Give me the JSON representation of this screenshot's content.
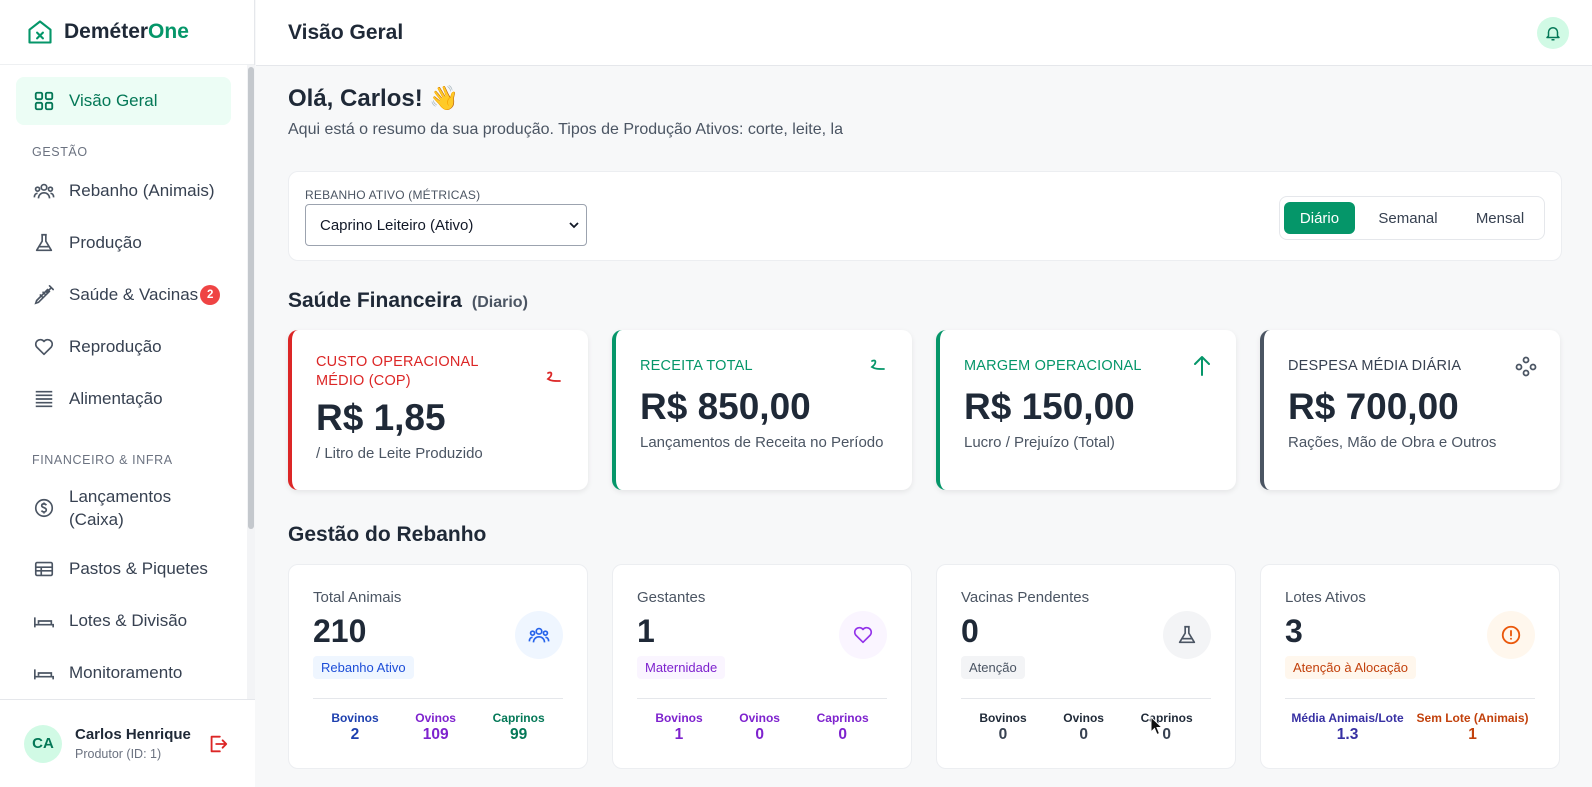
{
  "app": {
    "name_main": "Deméter",
    "name_accent": "One"
  },
  "sidebar": {
    "active": {
      "label": "Visão Geral",
      "icon": "grid-icon"
    },
    "sections": [
      {
        "title": "GESTÃO",
        "items": [
          {
            "label": "Rebanho (Animais)",
            "icon": "users-icon"
          },
          {
            "label": "Produção",
            "icon": "flask-icon"
          },
          {
            "label": "Saúde & Vacinas",
            "icon": "syringe-icon",
            "badge": "2"
          },
          {
            "label": "Reprodução",
            "icon": "heart-icon"
          },
          {
            "label": "Alimentação",
            "icon": "lines-icon"
          }
        ]
      },
      {
        "title": "FINANCEIRO & INFRA",
        "items": [
          {
            "label": "Lançamentos (Caixa)",
            "icon": "dollar-circle-icon"
          },
          {
            "label": "Pastos & Piquetes",
            "icon": "table-icon"
          },
          {
            "label": "Lotes & Divisão",
            "icon": "bed-icon"
          },
          {
            "label": "Monitoramento",
            "icon": "bed-icon"
          }
        ]
      }
    ],
    "user": {
      "initials": "CA",
      "name": "Carlos Henrique",
      "role": "Produtor (ID: 1)"
    }
  },
  "header": {
    "title": "Visão Geral"
  },
  "main": {
    "greeting": "Olá, Carlos! 👋",
    "subtitle": "Aqui está o resumo da sua produção. Tipos de Produção Ativos: corte, leite, la",
    "filter": {
      "label": "REBANHO ATIVO (MÉTRICAS)",
      "selected": "Caprino Leiteiro (Ativo)",
      "periods": [
        "Diário",
        "Semanal",
        "Mensal"
      ]
    },
    "finance": {
      "title": "Saúde Financeira",
      "period": "(Diario)",
      "cards": [
        {
          "label": "CUSTO OPERACIONAL MÉDIO (COP)",
          "value": "R$ 1,85",
          "desc": "/ Litro de Leite Produzido",
          "color": "#dc2626"
        },
        {
          "label": "RECEITA TOTAL",
          "value": "R$ 850,00",
          "desc": "Lançamentos de Receita no Período",
          "color": "#059669"
        },
        {
          "label": "MARGEM OPERACIONAL",
          "value": "R$ 150,00",
          "desc": "Lucro / Prejuízo (Total)",
          "color": "#059669"
        },
        {
          "label": "DESPESA MÉDIA DIÁRIA",
          "value": "R$ 700,00",
          "desc": "Rações, Mão de Obra e Outros",
          "color": "#4b5563"
        }
      ]
    },
    "herd": {
      "title": "Gestão do Rebanho",
      "cards": [
        {
          "label": "Total Animais",
          "value": "210",
          "pill": "Rebanho Ativo",
          "stats": [
            {
              "l": "Bovinos",
              "v": "2"
            },
            {
              "l": "Ovinos",
              "v": "109"
            },
            {
              "l": "Caprinos",
              "v": "99"
            }
          ]
        },
        {
          "label": "Gestantes",
          "value": "1",
          "pill": "Maternidade",
          "stats": [
            {
              "l": "Bovinos",
              "v": "1"
            },
            {
              "l": "Ovinos",
              "v": "0"
            },
            {
              "l": "Caprinos",
              "v": "0"
            }
          ]
        },
        {
          "label": "Vacinas Pendentes",
          "value": "0",
          "pill": "Atenção",
          "stats": [
            {
              "l": "Bovinos",
              "v": "0"
            },
            {
              "l": "Ovinos",
              "v": "0"
            },
            {
              "l": "Caprinos",
              "v": "0"
            }
          ]
        },
        {
          "label": "Lotes Ativos",
          "value": "3",
          "pill": "Atenção à Alocação",
          "stats": [
            {
              "l": "Média Animais/Lote",
              "v": "1.3"
            },
            {
              "l": "Sem Lote (Animais)",
              "v": "1"
            }
          ]
        }
      ]
    }
  }
}
